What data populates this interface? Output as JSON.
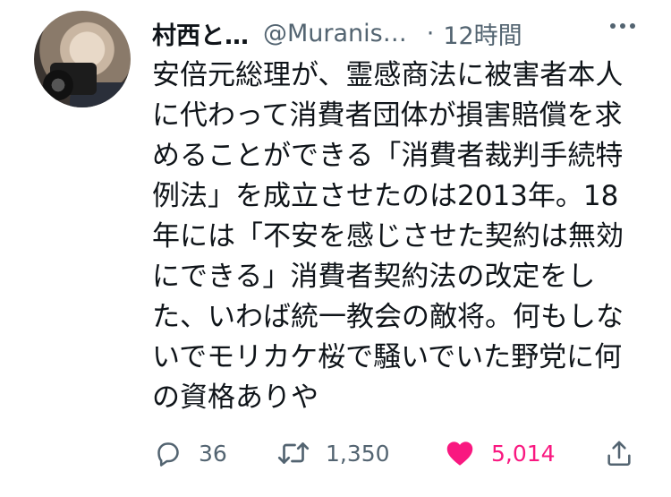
{
  "tweet": {
    "author_name": "村西と…",
    "author_handle": "@Muranis…",
    "time": "12時間",
    "separator": "·",
    "text_lines": [
      "安倍元総理が、霊感商法に被害者本人",
      "に代わって消費者団体が損害賠償を求",
      "めることができる「消費者裁判手続特",
      "例法」を成立させたのは2013年。18",
      "年には「不安を感じさせた契約は無効",
      "にできる」消費者契約法の改定をし",
      "た、いわば統一教会の敵将。何もしな",
      "いでモリカケ桜で騒いでいた野党に何",
      "の資格ありや"
    ],
    "actions": {
      "reply_count": "36",
      "retweet_count": "1,350",
      "like_count": "5,014"
    },
    "icons": {
      "reply": "reply-icon",
      "retweet": "retweet-icon",
      "like": "heart-icon",
      "share": "share-icon",
      "more": "more-icon"
    },
    "colors": {
      "like_active": "#f91880",
      "secondary_text": "#536471",
      "primary_text": "#0f1419"
    }
  }
}
